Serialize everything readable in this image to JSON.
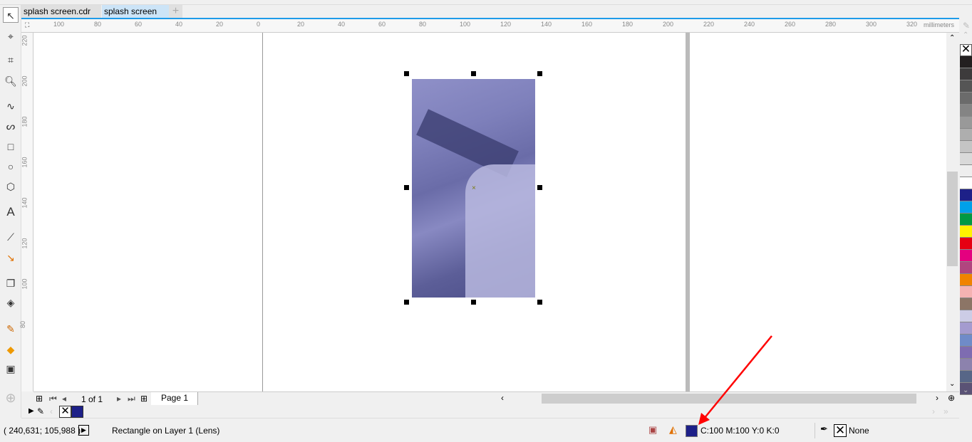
{
  "tabs": [
    {
      "label": "splash screen.cdr",
      "active": false
    },
    {
      "label": "splash screen",
      "active": true
    }
  ],
  "ruler": {
    "unit": "millimeters",
    "h_ticks": [
      "100",
      "80",
      "60",
      "40",
      "20",
      "0",
      "20",
      "40",
      "60",
      "80",
      "100",
      "120",
      "140",
      "160",
      "180",
      "200",
      "220",
      "240",
      "260",
      "280",
      "300",
      "320"
    ],
    "v_ticks": [
      "220",
      "200",
      "180",
      "160",
      "140",
      "120",
      "100",
      "80"
    ]
  },
  "page_nav": {
    "counter": "1 of 1",
    "page_tab": "Page 1"
  },
  "palette": [
    "#231f20",
    "#3d3b3c",
    "#555555",
    "#6b6b6b",
    "#848484",
    "#999999",
    "#aeaeae",
    "#c4c4c4",
    "#d9d9d9",
    "#eeeeee",
    "#ffffff",
    "#1d2088",
    "#00a0e9",
    "#009944",
    "#fff100",
    "#e60012",
    "#e4007f",
    "#b1457f",
    "#f08300",
    "#f5b2b2",
    "#8c7566",
    "#cccce6",
    "#a49bcf",
    "#6f8bc8",
    "#7e6cb1",
    "#8c82ad",
    "#576687",
    "#5a5275"
  ],
  "status": {
    "coordinates": "( 240,631; 105,988 )",
    "object_info": "Rectangle on Layer 1  (Lens)",
    "fill_color_text": "C:100 M:100 Y:0 K:0",
    "fill_color": "#1d2088",
    "outline_text": "None"
  },
  "colors": {
    "accent": "#1e9be9",
    "annotation_arrow": "#ff0000"
  }
}
